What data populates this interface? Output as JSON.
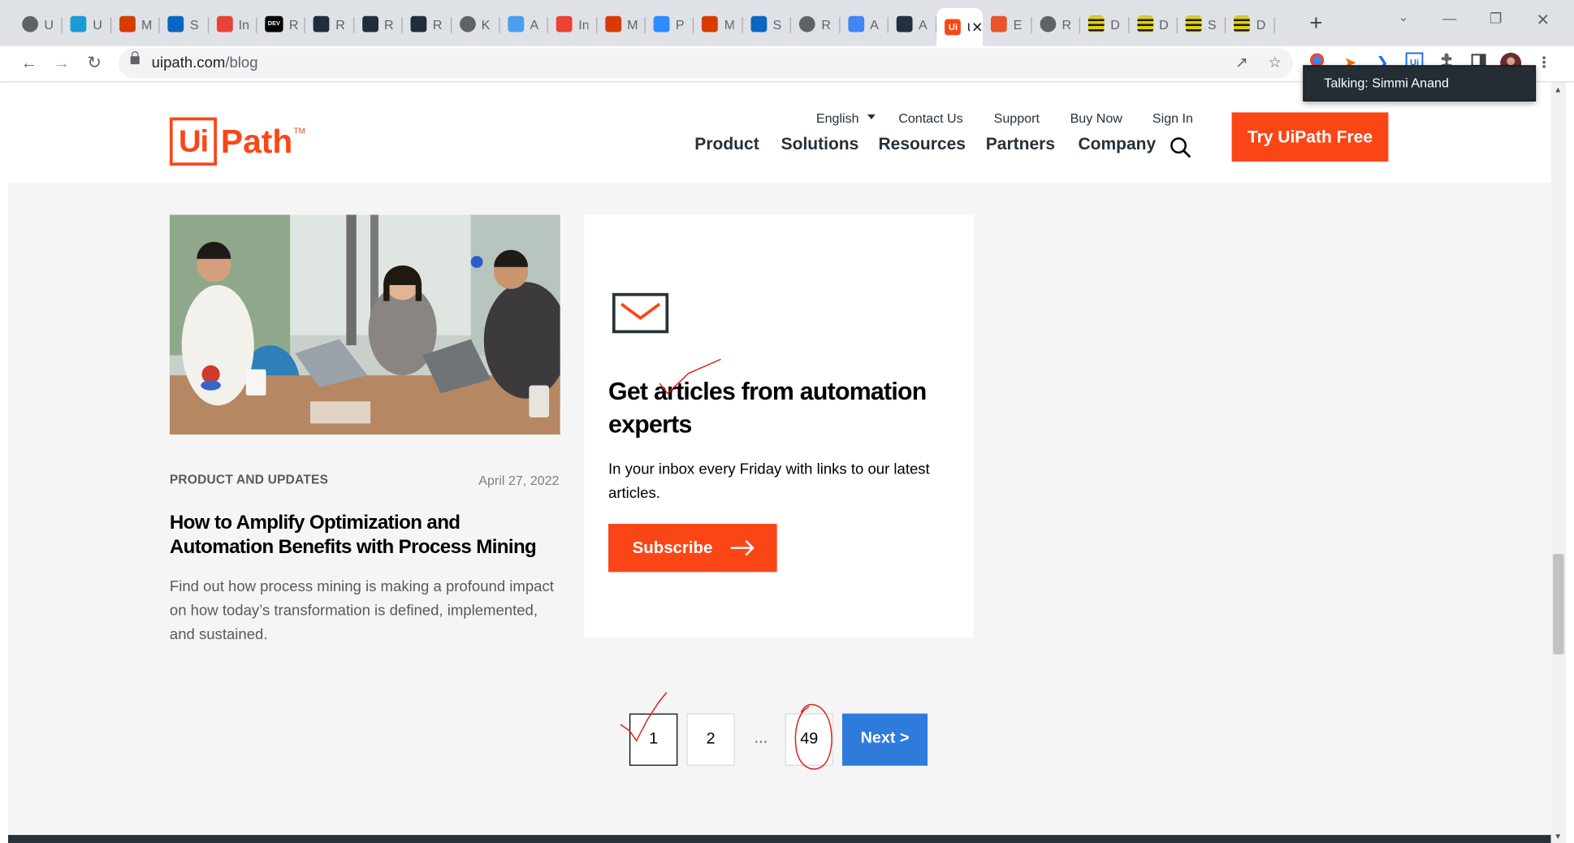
{
  "browser": {
    "tabs": [
      {
        "letter": "U",
        "icon": "globe-icon",
        "color": "#5f6368"
      },
      {
        "letter": "U",
        "icon": "uipath-swirl-icon",
        "color": "#1a9bd7"
      },
      {
        "letter": "M",
        "icon": "office-icon",
        "color": "#d83b01"
      },
      {
        "letter": "S",
        "icon": "cloud-icon",
        "color": "#0a66c2"
      },
      {
        "letter": "In",
        "icon": "gmail-icon",
        "color": "#ea4335"
      },
      {
        "letter": "R",
        "icon": "dev-icon",
        "color": "#000000"
      },
      {
        "letter": "R",
        "icon": "star-dark-icon",
        "color": "#1f2d3d"
      },
      {
        "letter": "R",
        "icon": "star-dark-icon",
        "color": "#1f2d3d"
      },
      {
        "letter": "R",
        "icon": "star-dark-icon",
        "color": "#1f2d3d"
      },
      {
        "letter": "K",
        "icon": "globe-icon",
        "color": "#5f6368"
      },
      {
        "letter": "A",
        "icon": "square-blue-icon",
        "color": "#4a9eed"
      },
      {
        "letter": "In",
        "icon": "gmail-icon",
        "color": "#ea4335"
      },
      {
        "letter": "M",
        "icon": "office-icon",
        "color": "#d83b01"
      },
      {
        "letter": "P",
        "icon": "zoom-icon",
        "color": "#2d8cff"
      },
      {
        "letter": "M",
        "icon": "office-icon",
        "color": "#d83b01"
      },
      {
        "letter": "S",
        "icon": "cloud-icon",
        "color": "#0a66c2"
      },
      {
        "letter": "R",
        "icon": "globe-icon",
        "color": "#5f6368"
      },
      {
        "letter": "A",
        "icon": "google-icon",
        "color": "#4285f4"
      },
      {
        "letter": "A",
        "icon": "amazon-icon",
        "color": "#232f3e"
      },
      {
        "letter": "Ui",
        "icon": "uipath-icon",
        "color": "#fa4616",
        "active": true
      },
      {
        "letter": "E",
        "icon": "chrome-red-icon",
        "color": "#e8542b"
      },
      {
        "letter": "R",
        "icon": "globe-icon",
        "color": "#5f6368"
      },
      {
        "letter": "D",
        "icon": "stripes-icon",
        "color": "#e2d000"
      },
      {
        "letter": "D",
        "icon": "stripes-icon",
        "color": "#e2d000"
      },
      {
        "letter": "S",
        "icon": "stripes-icon",
        "color": "#e2d000"
      },
      {
        "letter": "D",
        "icon": "stripes-icon",
        "color": "#e2d000"
      }
    ],
    "new_tab": "+",
    "url_host": "uipath.com",
    "url_path": "/blog"
  },
  "site": {
    "logo_ui": "Ui",
    "logo_path": "Path",
    "logo_tm": "TM",
    "language": "English",
    "util_links": [
      "Contact Us",
      "Support",
      "Buy Now",
      "Sign In"
    ],
    "nav": [
      "Product",
      "Solutions",
      "Resources",
      "Partners",
      "Company"
    ],
    "cta": "Try UiPath Free",
    "brand_color": "#fa4616"
  },
  "tooltip": "Talking: Simmi Anand",
  "article": {
    "category": "PRODUCT AND UPDATES",
    "date": "April 27, 2022",
    "title": "How to Amplify Optimization and Automation Benefits with Process Mining",
    "description": "Find out how process mining is making a profound impact on how today’s transformation is defined, implemented, and sustained."
  },
  "subscribe": {
    "title": "Get articles from automation experts",
    "description": "In your inbox every Friday with links to our latest articles.",
    "button": "Subscribe"
  },
  "pagination": {
    "pages": [
      "1",
      "2",
      "49"
    ],
    "ellipsis": "...",
    "next": "Next  >",
    "current": "1",
    "next_color": "#2f7bdc"
  }
}
